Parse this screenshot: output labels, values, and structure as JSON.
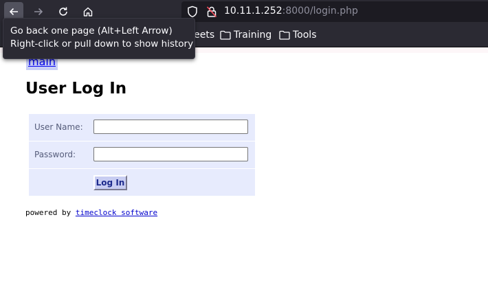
{
  "browser": {
    "url_host": "10.11.1.252",
    "url_rest": ":8000/login.php",
    "bookmarks": {
      "partial_label": "heat sheets",
      "training_label": "Training",
      "tools_label": "Tools"
    },
    "tooltip": {
      "line1": "Go back one page (Alt+Left Arrow)",
      "line2": "Right-click or pull down to show history"
    }
  },
  "page": {
    "main_link": "main",
    "title": "User Log In",
    "form": {
      "username_label": "User Name:",
      "username_value": "",
      "password_label": "Password:",
      "password_value": "",
      "submit_label": "Log In"
    },
    "footer": {
      "prefix": "powered by ",
      "link": "timeclock software"
    }
  },
  "colors": {
    "chrome": "#2b2a33",
    "form_background": "#e7ebfd",
    "link_highlight": "#c8cef6",
    "button": "#c8cdf2"
  }
}
